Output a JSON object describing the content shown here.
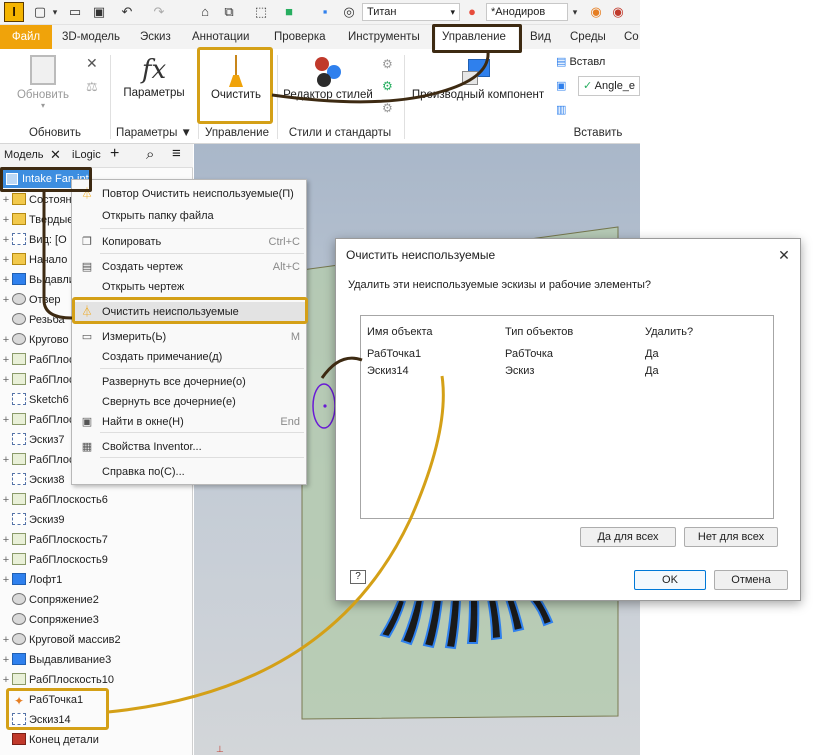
{
  "qat": {
    "material": "Титан",
    "appearance": "*Анодиров"
  },
  "tabs": [
    "Файл",
    "3D-модель",
    "Эскиз",
    "Аннотации",
    "Проверка",
    "Инструменты",
    "Управление",
    "Вид",
    "Среды",
    "Со"
  ],
  "ribbon": {
    "update_label": "Обновить",
    "params_label": "Параметры",
    "purge_label": "Очистить",
    "style_editor_label": "Редактор стилей",
    "derived_label": "Производный компонент",
    "insert_label": "Вставить",
    "insert_small": "Вставл",
    "angle_field": "Angle_e",
    "groups": {
      "update": "Обновить",
      "params": "Параметры ▼",
      "manage": "Управление",
      "styles": "Стили и стандарты",
      "insert": "Вставить"
    }
  },
  "browser": {
    "tab_model": "Модель",
    "tab_ilogic": "iLogic",
    "root": "Intake Fan.ipt",
    "items": [
      {
        "label": "Состоян",
        "icon": "folder"
      },
      {
        "label": "Твердые",
        "icon": "folder"
      },
      {
        "label": "Вид: [О",
        "icon": "sketch"
      },
      {
        "label": "Начало",
        "icon": "folder"
      },
      {
        "label": "Выдавли",
        "icon": "solid"
      },
      {
        "label": "Отвер",
        "icon": "feature"
      },
      {
        "label": "Резьба",
        "icon": "feature"
      },
      {
        "label": "Кругово",
        "icon": "feature"
      },
      {
        "label": "РабПлоск",
        "icon": "plane"
      },
      {
        "label": "РабПлоск",
        "icon": "plane"
      },
      {
        "label": "Sketch6",
        "icon": "sketch"
      },
      {
        "label": "РабПлос",
        "icon": "plane"
      },
      {
        "label": "Эскиз7",
        "icon": "sketch"
      },
      {
        "label": "РабПлос",
        "icon": "plane"
      },
      {
        "label": "Эскиз8",
        "icon": "sketch"
      },
      {
        "label": "РабПлоскость6",
        "icon": "plane"
      },
      {
        "label": "Эскиз9",
        "icon": "sketch"
      },
      {
        "label": "РабПлоскость7",
        "icon": "plane"
      },
      {
        "label": "РабПлоскость9",
        "icon": "plane"
      },
      {
        "label": "Лофт1",
        "icon": "solid"
      },
      {
        "label": "Сопряжение2",
        "icon": "feature"
      },
      {
        "label": "Сопряжение3",
        "icon": "feature"
      },
      {
        "label": "Круговой массив2",
        "icon": "feature"
      },
      {
        "label": "Выдавливание3",
        "icon": "solid"
      },
      {
        "label": "РабПлоскость10",
        "icon": "plane"
      },
      {
        "label": "РабТочка1",
        "icon": "point"
      },
      {
        "label": "Эскиз14",
        "icon": "sketch"
      },
      {
        "label": "Конец детали",
        "icon": "end"
      }
    ]
  },
  "context_menu": {
    "items": [
      {
        "label": "Повтор Очистить неиспользуемые(П)",
        "shortcut": ""
      },
      {
        "label": "Открыть папку файла",
        "shortcut": ""
      },
      {
        "label": "Копировать",
        "shortcut": "Ctrl+C"
      },
      {
        "label": "Создать чертеж",
        "shortcut": "Alt+C"
      },
      {
        "label": "Открыть чертеж",
        "shortcut": ""
      },
      {
        "label": "Очистить неиспользуемые",
        "shortcut": ""
      },
      {
        "label": "Измерить(Ь)",
        "shortcut": "M"
      },
      {
        "label": "Создать примечание(д)",
        "shortcut": ""
      },
      {
        "label": "Развернуть все дочерние(о)",
        "shortcut": ""
      },
      {
        "label": "Свернуть все дочерние(е)",
        "shortcut": ""
      },
      {
        "label": "Найти в окне(Н)",
        "shortcut": "End"
      },
      {
        "label": "Свойства Inventor...",
        "shortcut": ""
      },
      {
        "label": "Справка по(С)...",
        "shortcut": ""
      }
    ]
  },
  "dialog": {
    "title": "Очистить неиспользуемые",
    "message": "Удалить эти неиспользуемые эскизы и рабочие элементы?",
    "columns": [
      "Имя объекта",
      "Тип объектов",
      "Удалить?"
    ],
    "rows": [
      [
        "РабТочка1",
        "РабТочка",
        "Да"
      ],
      [
        "Эскиз14",
        "Эскиз",
        "Да"
      ]
    ],
    "yes_all": "Да для всех",
    "no_all": "Нет для всех",
    "ok": "OK",
    "cancel": "Отмена",
    "help": "?"
  },
  "colors": {
    "accent_file_tab": "#f0a30a",
    "highlight": "#d4a017",
    "highlight_dark": "#3d2a12",
    "solid_blue": "#2f80ed"
  }
}
